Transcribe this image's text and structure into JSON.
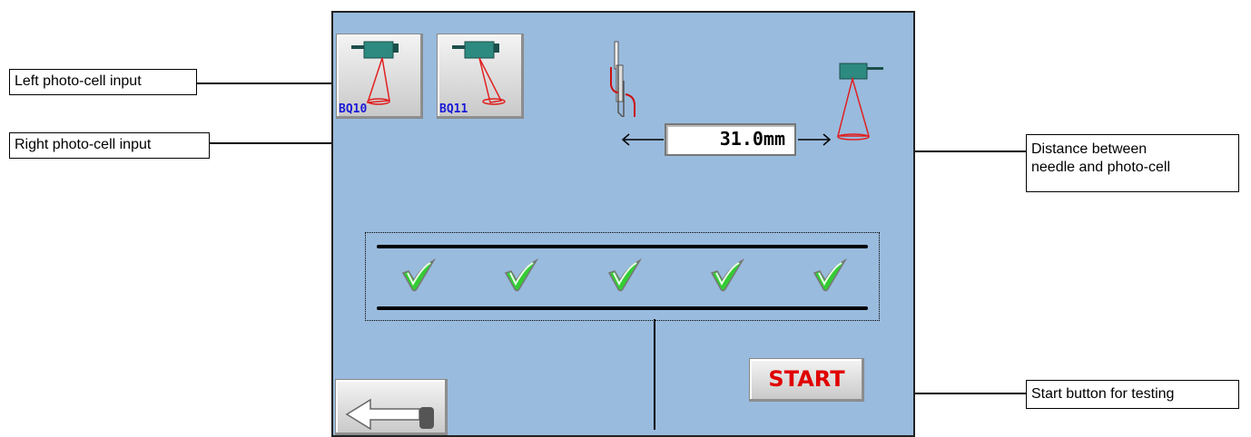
{
  "callouts": {
    "left_photocell": "Left photo-cell input",
    "right_photocell": "Right photo-cell input",
    "distance_line1": "Distance between",
    "distance_line2": "needle and photo-cell",
    "start_button": "Start button for testing"
  },
  "screen": {
    "left_sensor_label": "BQ10",
    "right_sensor_label": "BQ11",
    "distance_value": "31.0mm",
    "start_label": "START",
    "checks": [
      "check-icon",
      "check-icon",
      "check-icon",
      "check-icon",
      "check-icon"
    ]
  },
  "colors": {
    "screen_background": "#99bbdd",
    "start_text": "#e00000",
    "sensor_label": "#1a1ad8",
    "check_green": "#33cc33"
  }
}
